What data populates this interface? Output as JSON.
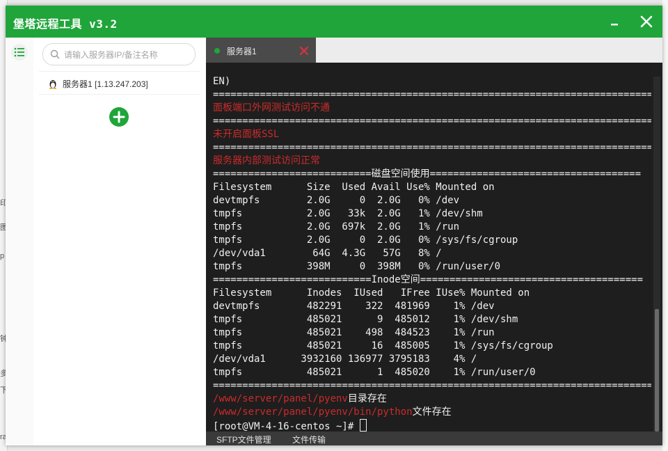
{
  "window": {
    "title": "堡塔远程工具 v3.2",
    "colors": {
      "accent": "#20a53a",
      "terminal_bg": "#1e1e1e",
      "error_text": "#cc2b2b"
    }
  },
  "sidebar": {
    "menu_icon": "list-icon",
    "search_placeholder": "请输入服务器IP/备注名称",
    "servers": [
      {
        "name": "服务器1 [1.13.247.203]",
        "icon": "linux-tux-icon"
      }
    ],
    "add_icon": "plus-icon"
  },
  "tabs": [
    {
      "label": "服务器1",
      "status": "connected"
    }
  ],
  "terminal": {
    "lines": [
      [
        {
          "t": "EN)"
        }
      ],
      [
        {
          "t": "============================================================================"
        }
      ],
      [
        {
          "t": "面板端口外网测试访问不通",
          "c": "red"
        }
      ],
      [
        {
          "t": "============================================================================"
        }
      ],
      [
        {
          "t": "未开启面板SSL",
          "c": "red"
        }
      ],
      [
        {
          "t": "============================================================================"
        }
      ],
      [
        {
          "t": "服务器内部测试访问正常",
          "c": "red"
        }
      ],
      [
        {
          "t": "===========================磁盘空间使用===================================="
        }
      ],
      [
        {
          "t": "Filesystem      Size  Used Avail Use% Mounted on"
        }
      ],
      [
        {
          "t": "devtmpfs        2.0G     0  2.0G   0% /dev"
        }
      ],
      [
        {
          "t": "tmpfs           2.0G   33k  2.0G   1% /dev/shm"
        }
      ],
      [
        {
          "t": "tmpfs           2.0G  697k  2.0G   1% /run"
        }
      ],
      [
        {
          "t": "tmpfs           2.0G     0  2.0G   0% /sys/fs/cgroup"
        }
      ],
      [
        {
          "t": "/dev/vda1        64G  4.3G   57G   8% /"
        }
      ],
      [
        {
          "t": "tmpfs           398M     0  398M   0% /run/user/0"
        }
      ],
      [
        {
          "t": "===========================Inode空间======================================"
        }
      ],
      [
        {
          "t": "Filesystem      Inodes  IUsed   IFree IUse% Mounted on"
        }
      ],
      [
        {
          "t": "devtmpfs        482291    322  481969    1% /dev"
        }
      ],
      [
        {
          "t": "tmpfs           485021      9  485012    1% /dev/shm"
        }
      ],
      [
        {
          "t": "tmpfs           485021    498  484523    1% /run"
        }
      ],
      [
        {
          "t": "tmpfs           485021     16  485005    1% /sys/fs/cgroup"
        }
      ],
      [
        {
          "t": "/dev/vda1      3932160 136977 3795183    4% /"
        }
      ],
      [
        {
          "t": "tmpfs           485021      1  485020    1% /run/user/0"
        }
      ],
      [
        {
          "t": "============================================================================"
        }
      ],
      [
        {
          "t": "/www/server/panel/pyenv",
          "c": "red"
        },
        {
          "t": "目录存在"
        }
      ],
      [
        {
          "t": "/www/server/panel/pyenv/bin/python",
          "c": "red"
        },
        {
          "t": "文件存在"
        }
      ],
      [
        {
          "t": "[root@VM-4-16-centos ~]# "
        },
        {
          "cursor": true
        }
      ]
    ]
  },
  "bottom_tabs": [
    "SFTP文件管理",
    "文件传输"
  ],
  "background_fragments": [
    "印",
    "图",
    "p",
    "钟",
    "多",
    "下",
    "ra"
  ]
}
